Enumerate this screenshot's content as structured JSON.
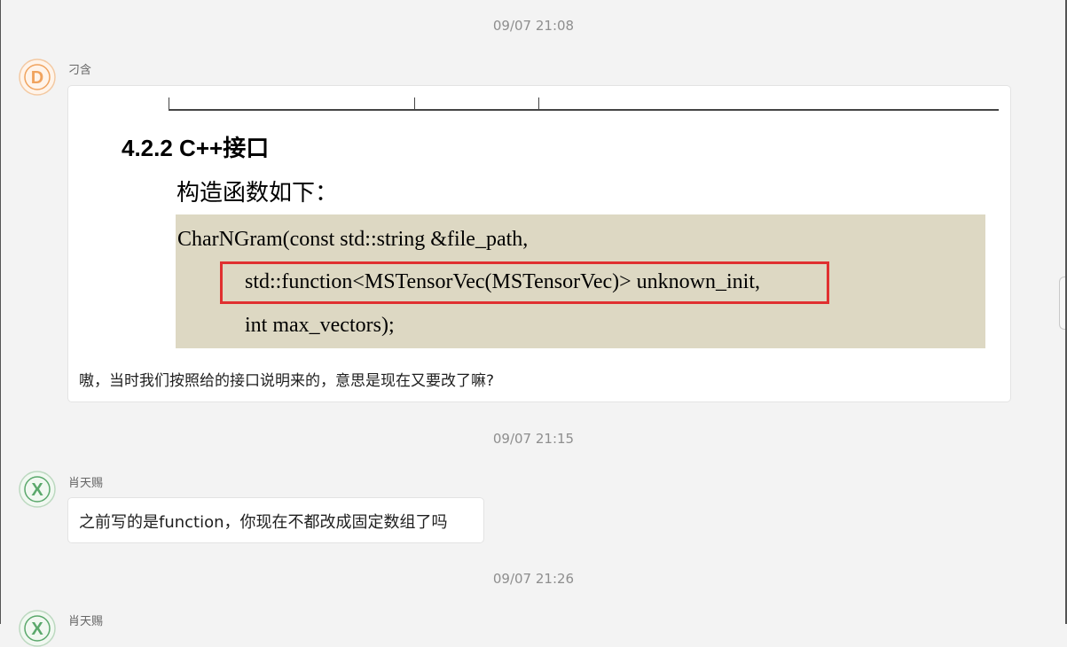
{
  "messages": [
    {
      "timestamp": "09/07 21:08",
      "sender": "刁含",
      "avatar_letter": "D",
      "avatar_color": "#f0a35e",
      "attachment": {
        "heading": "4.2.2  C++接口",
        "subheading": "构造函数如下：",
        "code_lines": [
          "CharNGram(const std::string &file_path,",
          "std::function<MSTensorVec(MSTensorVec)> unknown_init,",
          "int max_vectors);"
        ],
        "highlight_color": "#e03030",
        "code_background": "#ddd8c3"
      },
      "text": "嗷，当时我们按照给的接口说明来的，意思是现在又要改了嘛?"
    },
    {
      "timestamp": "09/07 21:15",
      "sender": "肖天赐",
      "avatar_letter": "X",
      "avatar_color": "#5aa86b",
      "text": "之前写的是function，你现在不都改成固定数组了吗"
    },
    {
      "timestamp": "09/07 21:26",
      "sender": "肖天赐",
      "avatar_letter": "X",
      "avatar_color": "#5aa86b"
    }
  ]
}
